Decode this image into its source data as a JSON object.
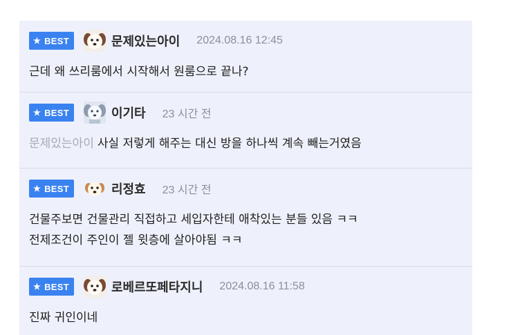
{
  "best_label": "BEST",
  "comments": [
    {
      "nickname": "문제있는아이",
      "time": "2024.08.16 12:45",
      "reply_to": "",
      "text": "근데 왜 쓰리룸에서 시작해서 원룸으로 끝나?"
    },
    {
      "nickname": "이기타",
      "time": "23 시간 전",
      "reply_to": "문제있는아이",
      "text": "사실 저렇게 해주는 대신 방을 하나씩 계속 빼는거였음"
    },
    {
      "nickname": "리정효",
      "time": "23 시간 전",
      "reply_to": "",
      "text": "건물주보면 건물관리 직접하고 세입자한테 애착있는 분들 있음 ㅋㅋ\n전제조건이 주인이 젤 윗층에 살아야됨 ㅋㅋ"
    },
    {
      "nickname": "로베르또페타지니",
      "time": "2024.08.16 11:58",
      "reply_to": "",
      "text": "진짜 귀인이네"
    }
  ],
  "colors": {
    "badge_bg": "#3a82f0",
    "list_bg": "#eef1fb",
    "time_text": "#8d8f96",
    "reply_to_text": "#a8aab1"
  },
  "icons": {
    "badge_icon": "star-icon",
    "avatar_icon": "dog-avatar-icon"
  }
}
